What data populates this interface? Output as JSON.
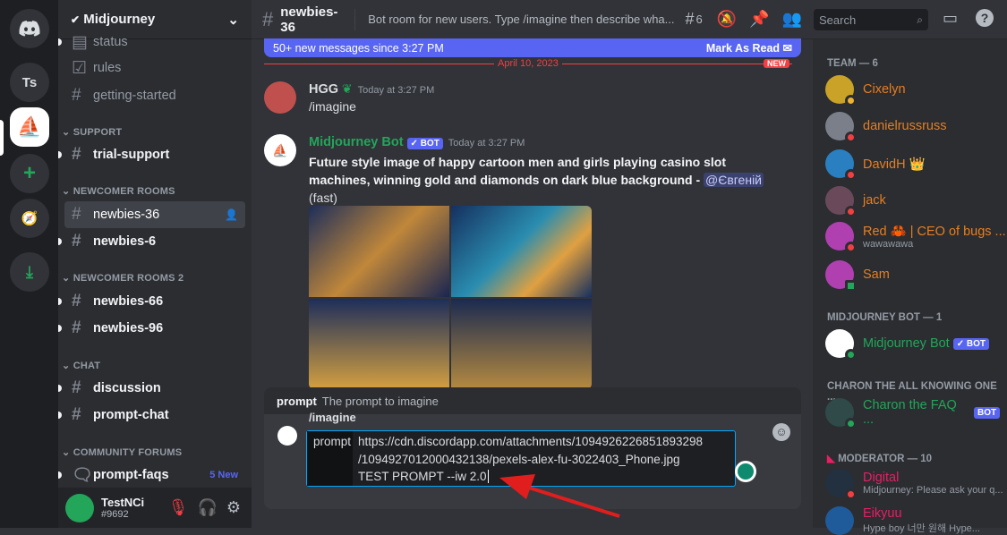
{
  "servers": [
    {
      "label": "Ts"
    }
  ],
  "guild": {
    "name": "Midjourney"
  },
  "channels": {
    "top": [
      "status",
      "rules",
      "getting-started"
    ],
    "cat_support": "SUPPORT",
    "support": [
      "trial-support"
    ],
    "cat_newcomer": "NEWCOMER ROOMS",
    "newcomer": [
      "newbies-36",
      "newbies-6"
    ],
    "cat_newcomer2": "NEWCOMER ROOMS 2",
    "newcomer2": [
      "newbies-66",
      "newbies-96"
    ],
    "cat_chat": "CHAT",
    "chat": [
      "discussion",
      "prompt-chat"
    ],
    "cat_forums": "COMMUNITY FORUMS",
    "forums": [
      {
        "name": "prompt-faqs",
        "badge": "5 New"
      }
    ]
  },
  "user": {
    "name": "TestNCi",
    "tag": "#9692"
  },
  "header": {
    "channel": "newbies-36",
    "topic": "Bot room for new users. Type /imagine then describe wha...",
    "threads_count": "6",
    "search_placeholder": "Search"
  },
  "banner": {
    "text": "50+ new messages since 3:27 PM",
    "action": "Mark As Read"
  },
  "divider": {
    "date": "April 10, 2023",
    "new": "NEW"
  },
  "messages": [
    {
      "author": "HGG",
      "time": "Today at 3:27 PM",
      "text": "/imagine",
      "color": "#dbdee1"
    },
    {
      "author": "Midjourney Bot",
      "badge": "✓ BOT",
      "time": "Today at 3:27 PM",
      "text": "Future style image of happy cartoon men and girls playing casino slot machines, winning gold and diamonds on dark blue background - ",
      "mention": "@Євгеній",
      "suffix": "(fast)",
      "color": "#23a55a"
    }
  ],
  "autocomplete": {
    "option": "prompt",
    "description": "The prompt to imagine"
  },
  "composer": {
    "command": "/imagine",
    "param": "prompt",
    "lines": [
      "https://cdn.discordapp.com/attachments/1094926226851893298",
      "/1094927012000432138/pexels-alex-fu-3022403_Phone.jpg",
      "TEST PROMPT --iw 2.0"
    ]
  },
  "members": {
    "cat_team": "TEAM — 6",
    "team": [
      {
        "name": "Cixelyn",
        "color": "#e67e22"
      },
      {
        "name": "danielrussruss",
        "color": "#e67e22"
      },
      {
        "name": "DavidH 👑",
        "color": "#e67e22"
      },
      {
        "name": "jack",
        "color": "#e67e22"
      },
      {
        "name": "Red 🦀 | CEO of bugs ...",
        "sub": "wawawawa",
        "color": "#e67e22"
      },
      {
        "name": "Sam",
        "color": "#e67e22"
      }
    ],
    "cat_mjbot": "MIDJOURNEY BOT — 1",
    "mjbot": {
      "name": "Midjourney Bot",
      "badge": "✓ BOT"
    },
    "cat_charon": "CHARON THE ALL KNOWING ONE ...",
    "charon": {
      "name": "Charon the FAQ ...",
      "badge": "BOT"
    },
    "cat_mod": "MODERATOR — 10",
    "mods": [
      {
        "name": "Digital",
        "sub": "Midjourney: Please ask your q..."
      },
      {
        "name": "Eikyuu",
        "sub": "Hype boy 너만 원해 Hype..."
      }
    ]
  },
  "colors": {
    "accent": "#5865f2",
    "new": "#f23f43",
    "online": "#23a55a",
    "team": "#e67e22",
    "mod": "#e91e63"
  }
}
